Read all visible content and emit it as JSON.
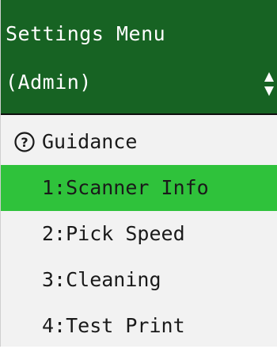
{
  "header": {
    "title": "Settings Menu",
    "role": "(Admin)",
    "scroll_icon": "up-down-arrows-icon",
    "background": "#176323"
  },
  "menu": {
    "guidance": {
      "icon": "help-circle-icon",
      "label": "Guidance"
    },
    "items": [
      {
        "label": "1:Scanner Info",
        "selected": true
      },
      {
        "label": "2:Pick Speed",
        "selected": false
      },
      {
        "label": "3:Cleaning",
        "selected": false
      },
      {
        "label": "4:Test Print",
        "selected": false
      }
    ],
    "selected_color": "#2fc23b"
  }
}
